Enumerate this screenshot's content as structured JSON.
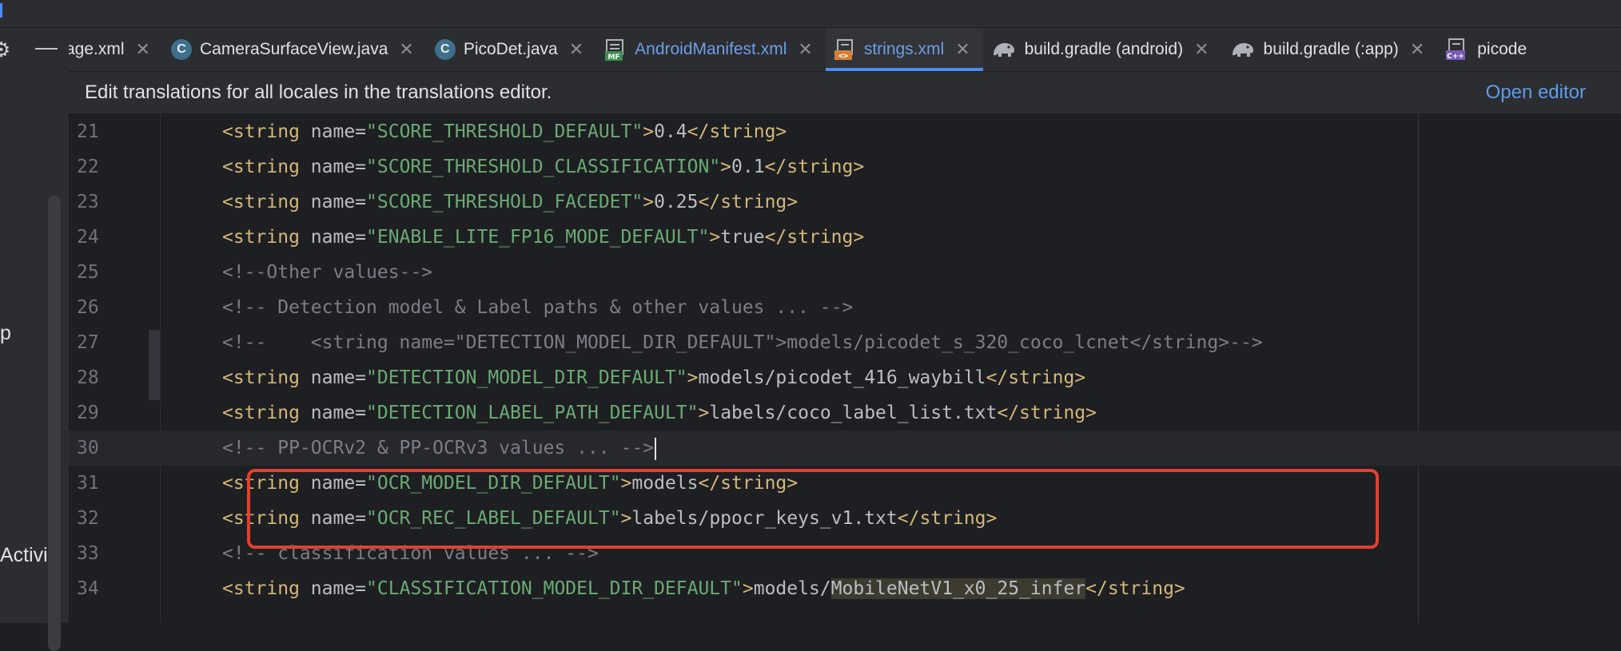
{
  "tabs": [
    {
      "label": "age.xml",
      "icon": "xml-file-icon"
    },
    {
      "label": "CameraSurfaceView.java",
      "icon": "java-class-icon",
      "glyph": "C"
    },
    {
      "label": "PicoDet.java",
      "icon": "java-class-icon",
      "glyph": "C"
    },
    {
      "label": "AndroidManifest.xml",
      "icon": "manifest-file-icon",
      "badge": "MF"
    },
    {
      "label": "strings.xml",
      "icon": "xml-resource-icon",
      "active": true
    },
    {
      "label": "build.gradle (android)",
      "icon": "gradle-elephant-icon"
    },
    {
      "label": "build.gradle (:app)",
      "icon": "gradle-elephant-icon"
    },
    {
      "label": "picode",
      "icon": "cpp-file-icon",
      "badge": "C++"
    }
  ],
  "banner": {
    "message": "Edit translations for all locales in the translations editor.",
    "link": "Open editor"
  },
  "sidebar": {
    "labels": [
      "p",
      "Activi"
    ]
  },
  "editor": {
    "current_line": "30",
    "lines": [
      {
        "n": "21",
        "kind": "str",
        "name": "SCORE_THRESHOLD_DEFAULT",
        "value": "0.4"
      },
      {
        "n": "22",
        "kind": "str",
        "name": "SCORE_THRESHOLD_CLASSIFICATION",
        "value": "0.1"
      },
      {
        "n": "23",
        "kind": "str",
        "name": "SCORE_THRESHOLD_FACEDET",
        "value": "0.25"
      },
      {
        "n": "24",
        "kind": "str",
        "name": "ENABLE_LITE_FP16_MODE_DEFAULT",
        "value": "true"
      },
      {
        "n": "25",
        "kind": "comment",
        "text": "<!--Other values-->"
      },
      {
        "n": "26",
        "kind": "comment",
        "text": "<!-- Detection model & Label paths & other values ... -->"
      },
      {
        "n": "27",
        "kind": "comment",
        "text": "<!--    <string name=\"DETECTION_MODEL_DIR_DEFAULT\">models/picodet_s_320_coco_lcnet</string>-->"
      },
      {
        "n": "28",
        "kind": "str",
        "name": "DETECTION_MODEL_DIR_DEFAULT",
        "value": "models/picodet_416_waybill"
      },
      {
        "n": "29",
        "kind": "str",
        "name": "DETECTION_LABEL_PATH_DEFAULT",
        "value": "labels/coco_label_list.txt"
      },
      {
        "n": "30",
        "kind": "comment",
        "text": "<!-- PP-OCRv2 & PP-OCRv3 values ... -->"
      },
      {
        "n": "31",
        "kind": "str",
        "name": "OCR_MODEL_DIR_DEFAULT",
        "value": "models"
      },
      {
        "n": "32",
        "kind": "str",
        "name": "OCR_REC_LABEL_DEFAULT",
        "value": "labels/ppocr_keys_v1.txt"
      },
      {
        "n": "33",
        "kind": "comment",
        "text": "<!-- classification values ... -->"
      },
      {
        "n": "34",
        "kind": "str",
        "name": "CLASSIFICATION_MODEL_DIR_DEFAULT",
        "value": "models/MobileNetV1_x0_25_infer",
        "highlight": "MobileNetV1_x0_25_infer"
      }
    ]
  },
  "colors": {
    "tag": "#d5b778",
    "attr_value": "#6aab73",
    "comment": "#7a7e85",
    "link": "#5f9ce8",
    "active_tab_underline": "#4b8df7",
    "annotation_box": "#e3402f"
  }
}
